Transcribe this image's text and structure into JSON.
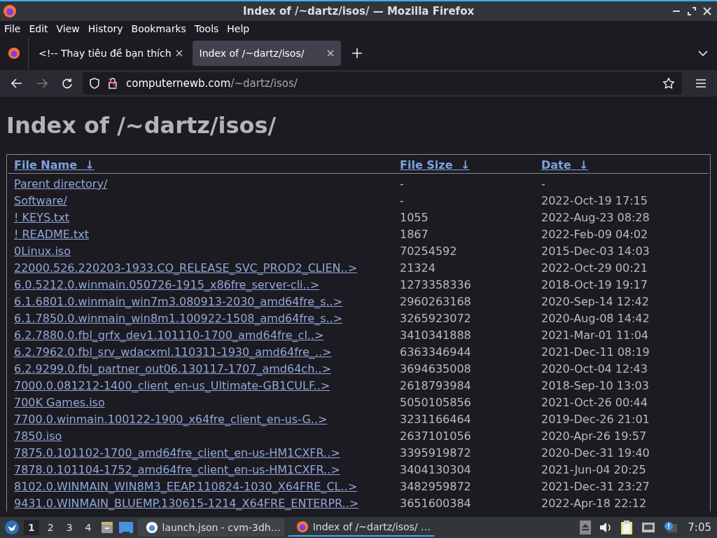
{
  "window": {
    "title": "Index of /~dartz/isos/ — Mozilla Firefox"
  },
  "menu": [
    "File",
    "Edit",
    "View",
    "History",
    "Bookmarks",
    "Tools",
    "Help"
  ],
  "tabs": [
    {
      "label": "<!-- Thay tiêu đề bạn thích",
      "selected": false
    },
    {
      "label": "Index of /~dartz/isos/",
      "selected": true
    }
  ],
  "address": {
    "domain": "computernewb.com",
    "path": "/~dartz/isos/"
  },
  "page": {
    "heading": "Index of /~dartz/isos/",
    "columns": [
      {
        "label": "File Name",
        "sort": "↓"
      },
      {
        "label": "File Size",
        "sort": "↓"
      },
      {
        "label": "Date",
        "sort": "↓"
      }
    ],
    "rows": [
      {
        "name": "Parent directory/",
        "size": "-",
        "date": "-"
      },
      {
        "name": "Software/",
        "size": "-",
        "date": "2022-Oct-19 17:15"
      },
      {
        "name": "! KEYS.txt",
        "size": "1055",
        "date": "2022-Aug-23 08:28"
      },
      {
        "name": "! README.txt",
        "size": "1867",
        "date": "2022-Feb-09 04:02"
      },
      {
        "name": "0Linux.iso",
        "size": "70254592",
        "date": "2015-Dec-03 14:03"
      },
      {
        "name": "22000.526.220203-1933.CO_RELEASE_SVC_PROD2_CLIEN..>",
        "size": "21324",
        "date": "2022-Oct-29 00:21"
      },
      {
        "name": "6.0.5212.0.winmain.050726-1915_x86fre_server-cli..>",
        "size": "1273358336",
        "date": "2018-Oct-19 19:17"
      },
      {
        "name": "6.1.6801.0.winmain_win7m3.080913-2030_amd64fre_s..>",
        "size": "2960263168",
        "date": "2020-Sep-14 12:42"
      },
      {
        "name": "6.1.7850.0.winmain_win8m1.100922-1508_amd64fre_s..>",
        "size": "3265923072",
        "date": "2020-Aug-08 14:42"
      },
      {
        "name": "6.2.7880.0.fbl_grfx_dev1.101110-1700_amd64fre_cl..>",
        "size": "3410341888",
        "date": "2021-Mar-01 11:04"
      },
      {
        "name": "6.2.7962.0.fbl_srv_wdacxml.110311-1930_amd64fre_..>",
        "size": "6363346944",
        "date": "2021-Dec-11 08:19"
      },
      {
        "name": "6.2.9299.0.fbl_partner_out06.130117-1707_amd64ch..>",
        "size": "3694635008",
        "date": "2020-Oct-04 12:43"
      },
      {
        "name": "7000.0.081212-1400_client_en-us_Ultimate-GB1CULF..>",
        "size": "2618793984",
        "date": "2018-Sep-10 13:03"
      },
      {
        "name": "700K Games.iso",
        "size": "5050105856",
        "date": "2021-Oct-26 00:44"
      },
      {
        "name": "7700.0.winmain.100122-1900_x64fre_client_en-us-G..>",
        "size": "3231166464",
        "date": "2019-Dec-26 21:01"
      },
      {
        "name": "7850.iso",
        "size": "2637101056",
        "date": "2020-Apr-26 19:57"
      },
      {
        "name": "7875.0.101102-1700_amd64fre_client_en-us-HM1CXFR..>",
        "size": "3395919872",
        "date": "2020-Dec-31 19:40"
      },
      {
        "name": "7878.0.101104-1752_amd64fre_client_en-us-HM1CXFR..>",
        "size": "3404130304",
        "date": "2021-Jun-04 20:25"
      },
      {
        "name": "8102.0.WINMAIN_WIN8M3_EEAP.110824-1030_X64FRE_CL..>",
        "size": "3482959872",
        "date": "2021-Dec-31 23:27"
      },
      {
        "name": "9431.0.WINMAIN_BLUEMP.130615-1214_X64FRE_ENTERPR..>",
        "size": "3651600384",
        "date": "2022-Apr-18 22:12"
      }
    ]
  },
  "taskbar": {
    "workspaces": [
      {
        "label": "1",
        "selected": true
      },
      {
        "label": "2",
        "selected": false
      },
      {
        "label": "3",
        "selected": false
      },
      {
        "label": "4",
        "selected": false
      }
    ],
    "tasks": [
      {
        "label": "launch.json - cvm-3dh…",
        "selected": false,
        "kind": "editor"
      },
      {
        "label": "Index of /~dartz/isos/ …",
        "selected": true,
        "kind": "browser"
      }
    ],
    "clock": "7:05"
  }
}
